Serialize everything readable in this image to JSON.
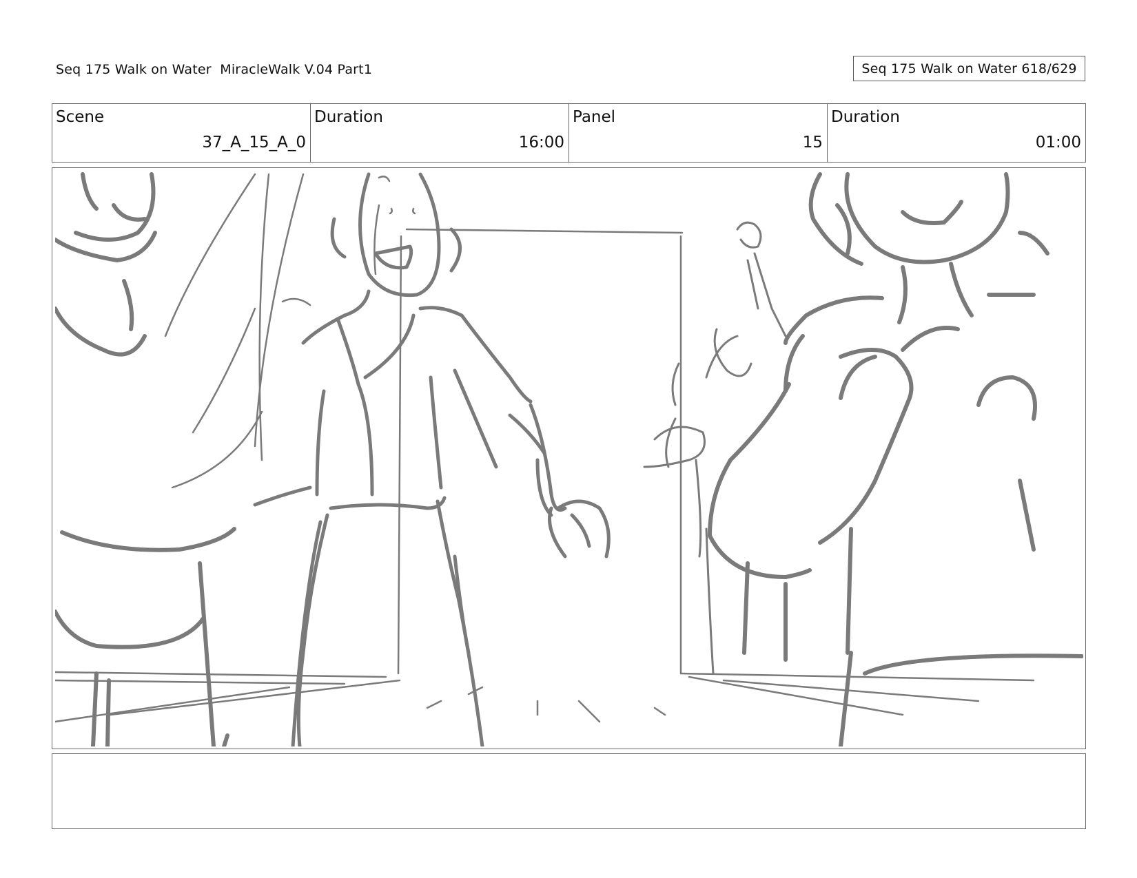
{
  "header": {
    "title": "Seq 175 Walk on Water  MiracleWalk V.04 Part1",
    "page_badge": "Seq 175 Walk on Water 618/629"
  },
  "info": {
    "scene_label": "Scene",
    "scene_value": "37_A_15_A_0",
    "scene_duration_label": "Duration",
    "scene_duration_value": "16:00",
    "panel_label": "Panel",
    "panel_value": "15",
    "panel_duration_label": "Duration",
    "panel_duration_value": "01:00"
  },
  "notes": {
    "text": ""
  },
  "colors": {
    "sketch_stroke": "#7a7a7a",
    "border": "#666666"
  }
}
